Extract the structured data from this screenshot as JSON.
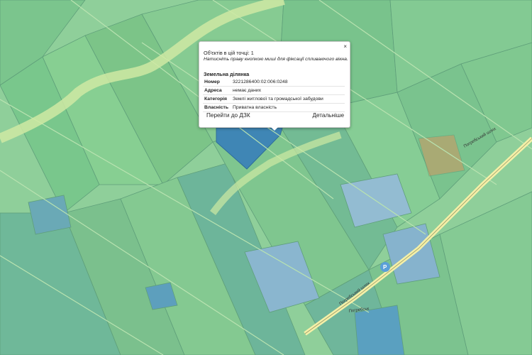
{
  "popup": {
    "objects_count": "Об'єктів в цій точці: 1",
    "hint": "Натисніть праву кнопкою миші для фіксації спливаючого вікна.",
    "close": "×",
    "title": "Земельна ділянка",
    "rows": [
      {
        "key": "Номер",
        "value": "3221286400:02:006:0248"
      },
      {
        "key": "Адреса",
        "value": "немає даних"
      },
      {
        "key": "Категорія",
        "value": "Землі житлової та громадської забудови"
      },
      {
        "key": "Власність",
        "value": "Приватна власність"
      }
    ],
    "link_dzk": "Перейти до ДЗК",
    "link_details": "Детальніше"
  },
  "map": {
    "road_labels": [
      "Погребський шлях",
      "Погребський шлях",
      "Погребськ"
    ],
    "parking_label": "P",
    "colors": {
      "background": "#8fcf9a",
      "parcel_green": "#7fcb8a",
      "parcel_teal": "#6bb59a",
      "parcel_blue": "#8ab6cf",
      "selected": "#3f86b5",
      "road": "#f4f0a8"
    }
  }
}
